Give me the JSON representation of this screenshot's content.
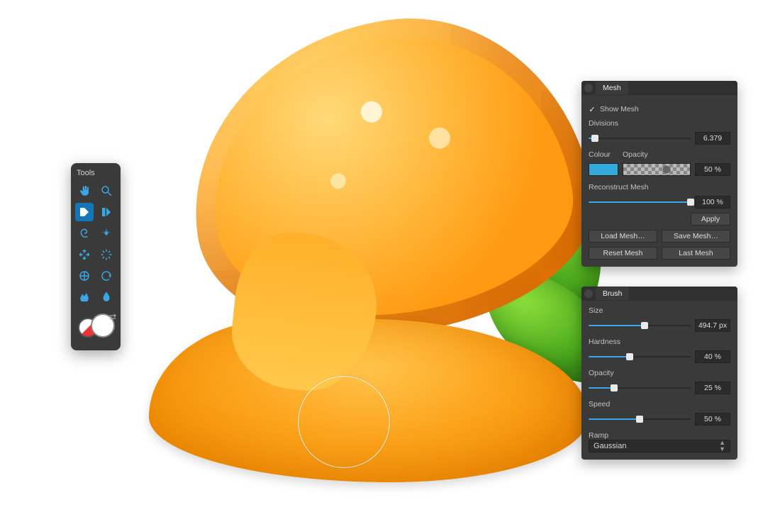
{
  "tools_panel": {
    "title": "Tools",
    "items": [
      {
        "name": "hand-tool-icon",
        "label": "Hand"
      },
      {
        "name": "zoom-tool-icon",
        "label": "Zoom"
      },
      {
        "name": "liquify-push-icon",
        "label": "Push Forward",
        "selected": true
      },
      {
        "name": "liquify-push-left-icon",
        "label": "Push Left"
      },
      {
        "name": "twirl-tool-icon",
        "label": "Twirl"
      },
      {
        "name": "pinch-tool-icon",
        "label": "Pinch"
      },
      {
        "name": "punch-tool-icon",
        "label": "Punch"
      },
      {
        "name": "turbulence-tool-icon",
        "label": "Turbulence"
      },
      {
        "name": "mesh-clone-icon",
        "label": "Mesh Clone"
      },
      {
        "name": "reconstruct-tool-icon",
        "label": "Reconstruct"
      },
      {
        "name": "freeze-tool-icon",
        "label": "Freeze"
      },
      {
        "name": "thaw-tool-icon",
        "label": "Thaw"
      }
    ]
  },
  "mesh_panel": {
    "tab": "Mesh",
    "show_mesh_label": "Show Mesh",
    "show_mesh_checked": true,
    "divisions_label": "Divisions",
    "divisions_value": "6.379",
    "divisions_pct": 6,
    "colour_label": "Colour",
    "opacity_label": "Opacity",
    "opacity_value": "50 %",
    "colour_hex": "#33aade",
    "reconstruct_label": "Reconstruct Mesh",
    "reconstruct_value": "100 %",
    "reconstruct_pct": 100,
    "apply_label": "Apply",
    "load_label": "Load Mesh…",
    "save_label": "Save Mesh…",
    "reset_label": "Reset Mesh",
    "last_label": "Last Mesh"
  },
  "brush_panel": {
    "tab": "Brush",
    "size_label": "Size",
    "size_value": "494.7 px",
    "size_pct": 55,
    "hardness_label": "Hardness",
    "hardness_value": "40 %",
    "hardness_pct": 40,
    "opacity_label": "Opacity",
    "opacity_value": "25 %",
    "opacity_pct": 25,
    "speed_label": "Speed",
    "speed_value": "50 %",
    "speed_pct": 50,
    "ramp_label": "Ramp",
    "ramp_value": "Gaussian"
  }
}
